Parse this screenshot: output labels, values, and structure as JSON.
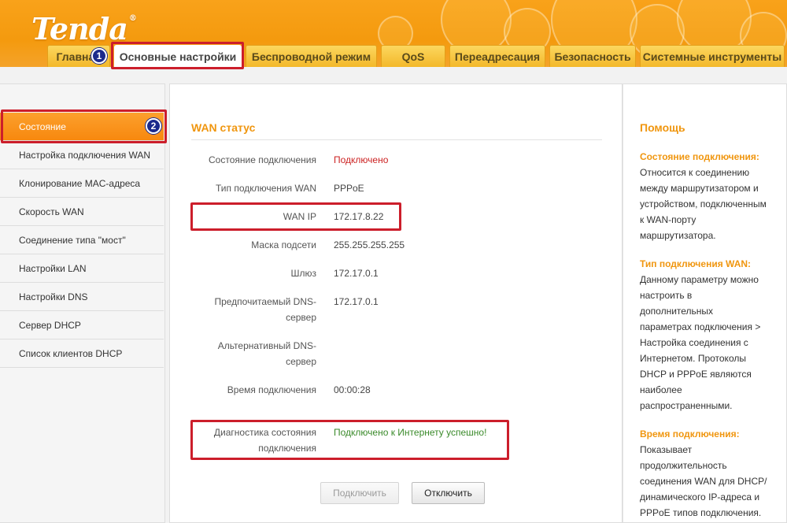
{
  "brand": {
    "logo_text": "Tenda",
    "reg_mark": "®"
  },
  "tabs": [
    {
      "label": "Главная"
    },
    {
      "label": "Основные настройки"
    },
    {
      "label": "Беспроводной режим"
    },
    {
      "label": "QoS"
    },
    {
      "label": "Переадресация"
    },
    {
      "label": "Безопасность"
    },
    {
      "label": "Системные инструменты"
    }
  ],
  "sidebar": {
    "items": [
      {
        "label": "Состояние"
      },
      {
        "label": "Настройка подключения WAN"
      },
      {
        "label": "Клонирование MAC-адреса"
      },
      {
        "label": "Скорость WAN"
      },
      {
        "label": "Соединение типа \"мост\""
      },
      {
        "label": "Настройки LAN"
      },
      {
        "label": "Настройки DNS"
      },
      {
        "label": "Сервер DHCP"
      },
      {
        "label": "Список клиентов DHCP"
      }
    ]
  },
  "main": {
    "title": "WAN статус",
    "rows": {
      "connection_state": {
        "label": "Состояние подключения",
        "value": "Подключено"
      },
      "connection_type": {
        "label": "Тип подключения WAN",
        "value": "PPPoE"
      },
      "wan_ip": {
        "label": "WAN IP",
        "value": "172.17.8.22"
      },
      "subnet_mask": {
        "label": "Маска подсети",
        "value": "255.255.255.255"
      },
      "gateway": {
        "label": "Шлюз",
        "value": "172.17.0.1"
      },
      "preferred_dns": {
        "label_line1": "Предпочитаемый DNS-",
        "label_line2": "сервер",
        "value": "172.17.0.1"
      },
      "alternate_dns": {
        "label_line1": "Альтернативный DNS-",
        "label_line2": "сервер",
        "value": ""
      },
      "connection_time": {
        "label": "Время подключения",
        "value": "00:00:28"
      },
      "diagnostics": {
        "label_line1": "Диагностика состояния",
        "label_line2": "подключения",
        "value": "Подключено к Интернету успешно!"
      }
    },
    "buttons": {
      "connect": "Подключить",
      "disconnect": "Отключить"
    }
  },
  "help": {
    "title": "Помощь",
    "sections": [
      {
        "heading": "Состояние подключения:",
        "lines": [
          "Относится к соединению",
          "между маршрутизатором и",
          "устройством, подключенным",
          "к WAN-порту",
          "маршрутизатора."
        ]
      },
      {
        "heading": "Тип подключения WAN:",
        "lines": [
          "Данному параметру можно",
          "настроить в",
          "дополнительных",
          "параметрах подключения >",
          "Настройка соединения с",
          "Интернетом. Протоколы",
          "DHCP и PPPoE являются",
          "наиболее",
          "распространенными."
        ]
      },
      {
        "heading": "Время подключения:",
        "lines": [
          "Показывает",
          "продолжительность",
          "соединения WAN для DHCP/",
          "динамического IP-адреса и",
          "PPPoE типов подключения."
        ]
      }
    ]
  },
  "annotations": {
    "badge_1": "1",
    "badge_2": "2"
  },
  "colors": {
    "accent_orange": "#f0960f",
    "annotation_red": "#cc1e2b",
    "badge_blue": "#1b2a8c",
    "status_red": "#cc2222",
    "status_green": "#3a8a2a"
  }
}
